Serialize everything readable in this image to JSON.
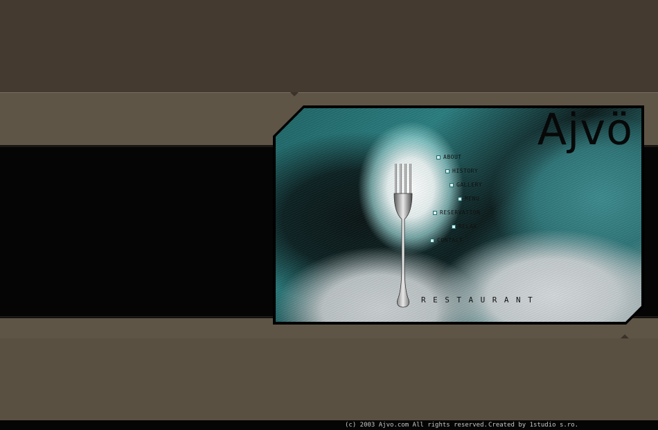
{
  "brand": {
    "logo_text": "Ajvö",
    "tagline": "RESTAURANT"
  },
  "nav": [
    {
      "label": "ABOUT"
    },
    {
      "label": "HISTORY"
    },
    {
      "label": "GALLERY"
    },
    {
      "label": "MENU"
    },
    {
      "label": "RESERVATION"
    },
    {
      "label": "RELAX"
    },
    {
      "label": "CONTACT"
    }
  ],
  "footer": {
    "copyright": "(c) 2003 Ajvo.com All rights reserved.",
    "credit": "Created by 1studio s.ro."
  },
  "colors": {
    "background": "#443a30",
    "band": "#5f5547",
    "accent_teal": "#2b7e80",
    "black": "#050505"
  },
  "icons": {
    "fork": "fork-icon",
    "bullet": "square-bullet-icon"
  }
}
